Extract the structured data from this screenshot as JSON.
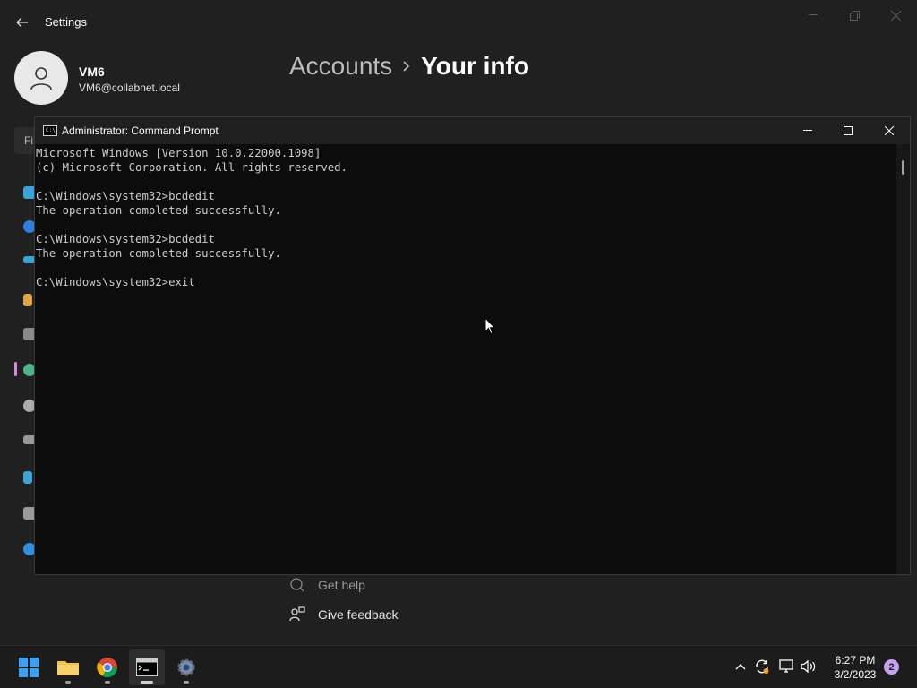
{
  "settings": {
    "title": "Settings",
    "profile": {
      "name": "VM6",
      "email": "VM6@collabnet.local"
    },
    "breadcrumb": {
      "parent": "Accounts",
      "current": "Your info"
    },
    "search_placeholder": "Fi",
    "links": {
      "help": "Get help",
      "feedback": "Give feedback"
    }
  },
  "cmd": {
    "title": "Administrator: Command Prompt",
    "lines": [
      "Microsoft Windows [Version 10.0.22000.1098]",
      "(c) Microsoft Corporation. All rights reserved.",
      "",
      "C:\\Windows\\system32>bcdedit",
      "The operation completed successfully.",
      "",
      "C:\\Windows\\system32>bcdedit",
      "The operation completed successfully.",
      "",
      "C:\\Windows\\system32>exit"
    ]
  },
  "taskbar": {
    "apps": [
      {
        "name": "start",
        "icon": "windows-logo-icon"
      },
      {
        "name": "file-explorer",
        "icon": "folder-icon"
      },
      {
        "name": "chrome",
        "icon": "chrome-icon"
      },
      {
        "name": "command-prompt",
        "icon": "terminal-icon"
      },
      {
        "name": "settings",
        "icon": "gear-icon"
      }
    ],
    "clock": {
      "time": "6:27 PM",
      "date": "3/2/2023"
    },
    "notification_count": "2"
  },
  "colors": {
    "accent": "#d78ae0",
    "cmd_background": "#0c0c0c",
    "cmd_text": "#cccccc",
    "badge": "#c5a3f0"
  }
}
